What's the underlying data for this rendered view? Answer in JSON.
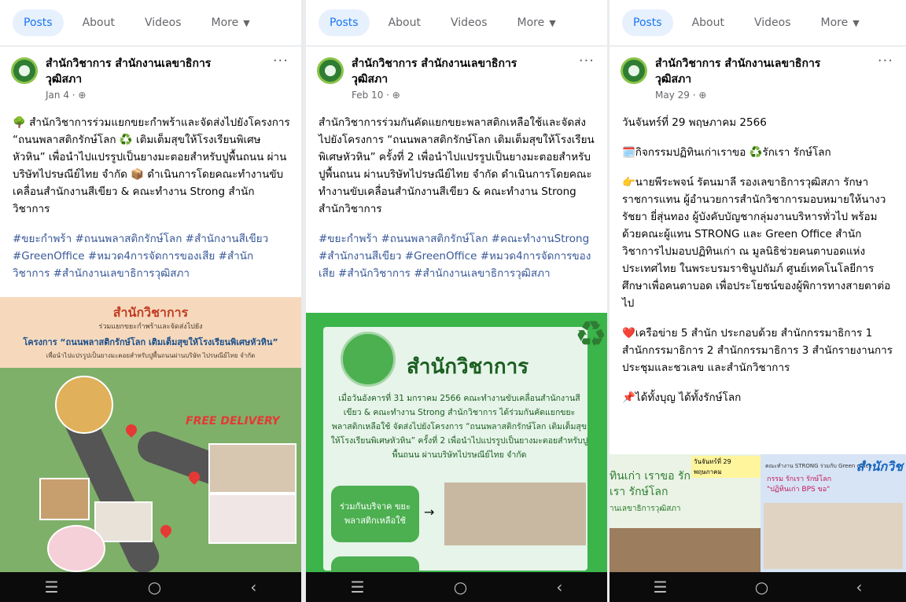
{
  "tabs": [
    {
      "label": "Posts"
    },
    {
      "label": "About"
    },
    {
      "label": "Videos"
    },
    {
      "label": "More"
    }
  ],
  "more_caret": "▼",
  "posts": [
    {
      "page_name": "สำนักวิชาการ สำนักงานเลขาธิการวุฒิสภา",
      "date": "Jan 4 · ",
      "menu": "···",
      "paragraphs": [
        "🌳 สำนักวิชาการร่วมแยกขยะกำพร้าและจัดส่งไปยังโครงการ “ถนนพลาสติกรักษ์โลก ♻️ เติมเต็มสุขให้โรงเรียนพิเศษหัวหิน” เพื่อนำไปแปรรูปเป็นยางมะตอยสำหรับปูพื้นถนน ผ่านบริษัทไปรษณีย์ไทย จำกัด 📦 ดำเนินการโดยคณะทำงานขับเคลื่อนสำนักงานสีเขียว & คณะทำงาน Strong สำนักวิชาการ"
      ],
      "tags": "#ขยะกำพร้า #ถนนพลาสติกรักษ์โลก #สำนักงานสีเขียว #GreenOffice #หมวด4การจัดการของเสีย #สำนักวิชาการ #สำนักงานเลขาธิการวุฒิสภา",
      "image": {
        "title": "สำนักวิชาการ",
        "line1": "ร่วมแยกขยะกำพร้าและจัดส่งไปยัง",
        "line2": "โครงการ “ถนนพลาสติกรักษ์โลก เติมเต็มสุขให้โรงเรียนพิเศษหัวหิน”",
        "line3": "เพื่อนำไปแปรรูปเป็นยางมะตอยสำหรับปูพื้นถนนผ่านบริษัท ไปรษณีย์ไทย จำกัด",
        "badge": "FREE DELIVERY"
      }
    },
    {
      "page_name": "สำนักวิชาการ สำนักงานเลขาธิการวุฒิสภา",
      "date": "Feb 10 · ",
      "menu": "···",
      "paragraphs": [
        "สำนักวิชาการร่วมกันคัดแยกขยะพลาสติกเหลือใช้และจัดส่งไปยังโครงการ “ถนนพลาสติกรักษ์โลก เติมเต็มสุขให้โรงเรียนพิเศษหัวหิน” ครั้งที่ 2 เพื่อนำไปแปรรูปเป็นยางมะตอยสำหรับปูพื้นถนน ผ่านบริษัทไปรษณีย์ไทย จำกัด ดำเนินการโดยคณะทำงานขับเคลื่อนสำนักงานสีเขียว & คณะทำงาน Strong สำนักวิชาการ"
      ],
      "tags": "#ขยะกำพร้า #ถนนพลาสติกรักษ์โลก #คณะทำงานStrong #สำนักงานสีเขียว #GreenOffice #หมวด4การจัดการของเสีย #สำนักวิชาการ #สำนักงานเลขาธิการวุฒิสภา",
      "image": {
        "title": "สำนักวิชาการ",
        "para": "เมื่อวันอังคารที่ 31 มกราคม 2566 คณะทำงานขับเคลื่อนสำนักงานสีเขียว & คณะทำงาน Strong สำนักวิชาการ ได้ร่วมกันคัดแยกขยะพลาสติกเหลือใช้ จัดส่งไปยังโครงการ “ถนนพลาสติกรักษ์โลก เติมเต็มสุขให้โรงเรียนพิเศษหัวหิน” ครั้งที่ 2 เพื่อนำไปแปรรูปเป็นยางมะตอยสำหรับปูพื้นถนน ผ่านบริษัทไปรษณีย์ไทย จำกัด",
        "btn": "ร่วมกันบริจาค ขยะพลาสติกเหลือใช้"
      }
    },
    {
      "page_name": "สำนักวิชาการ สำนักงานเลขาธิการวุฒิสภา",
      "date": "May 29 · ",
      "menu": "···",
      "paragraphs": [
        "วันจันทร์ที่ 29 พฤษภาคม 2566",
        "🗓️กิจกรรมปฏิทินเก่าเราขอ ♻️รักเรา รักษ์โลก",
        "👉นายพีระพจน์ รัตนมาลี รองเลขาธิการวุฒิสภา รักษาราชการแทน ผู้อำนวยการสำนักวิชาการมอบหมายให้นางวรัชยา ยี่สุ่นทอง ผู้บังคับบัญชากลุ่มงานบริหารทั่วไป พร้อมด้วยคณะผู้แทน STRONG และ Green Office สำนักวิชาการไปมอบปฏิทินเก่า ณ มูลนิธิช่วยคนตาบอดแห่งประเทศไทย ในพระบรมราชินูปถัมภ์ ศูนย์เทคโนโลยีการศึกษาเพื่อคนตาบอด เพื่อประโยชน์ของผู้พิการทางสายตาต่อไป",
        "❤️เครือข่าย 5 สำนัก ประกอบด้วย สำนักกรรมาธิการ 1 สำนักกรรมาธิการ 2 สำนักกรรมาธิการ 3 สำนักรายงานการประชุมและชวเลข และสำนักวิชาการ",
        "📌ได้ทั้งบุญ ได้ทั้งรักษ์โลก"
      ],
      "image": {
        "date": "วันจันทร์ที่ 29 พฤษภาคม",
        "left_text": "ทินเก่า เราขอ รักเรา รักษ์โลก",
        "left_small": "านเลขาธิการวุฒิสภา",
        "right_title": "สำนักวิช",
        "right_sub": "คณะทำงาน STRONG ร่วมกับ Green office",
        "right_box": "กรรม รักเรา รักษ์โลก \"ปฏิทินเก่า BPS ขอ\""
      }
    }
  ],
  "nav": {
    "menu": "☰",
    "home": "○",
    "back": "‹"
  }
}
